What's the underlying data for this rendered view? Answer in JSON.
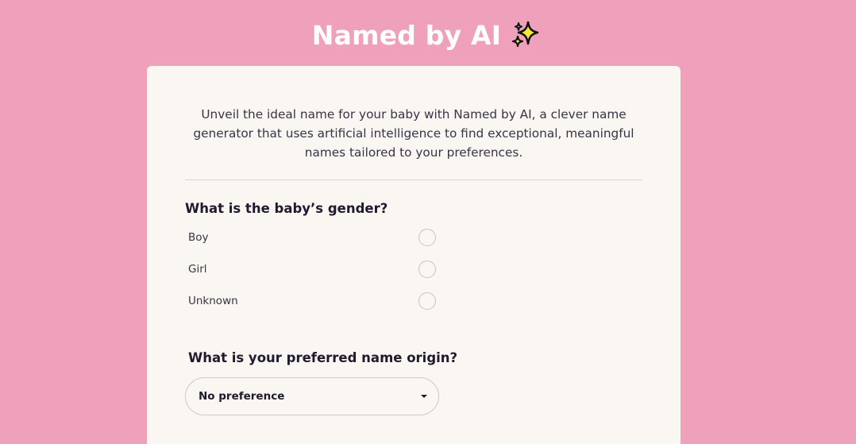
{
  "header": {
    "title": "Named by AI",
    "icon": "sparkles-icon"
  },
  "intro": {
    "text": "Unveil the ideal name for your baby with Named by AI, a clever name generator that uses artificial intelligence to find exceptional, meaningful names tailored to your preferences."
  },
  "gender": {
    "question": "What is the baby’s gender?",
    "options": [
      {
        "label": "Boy"
      },
      {
        "label": "Girl"
      },
      {
        "label": "Unknown"
      }
    ]
  },
  "origin": {
    "question": "What is your preferred name origin?",
    "selected": "No preference"
  },
  "colors": {
    "background": "#efa0bb",
    "card": "#faf6f2",
    "text": "#1f1a2e",
    "sparkle": "#f7e836"
  }
}
